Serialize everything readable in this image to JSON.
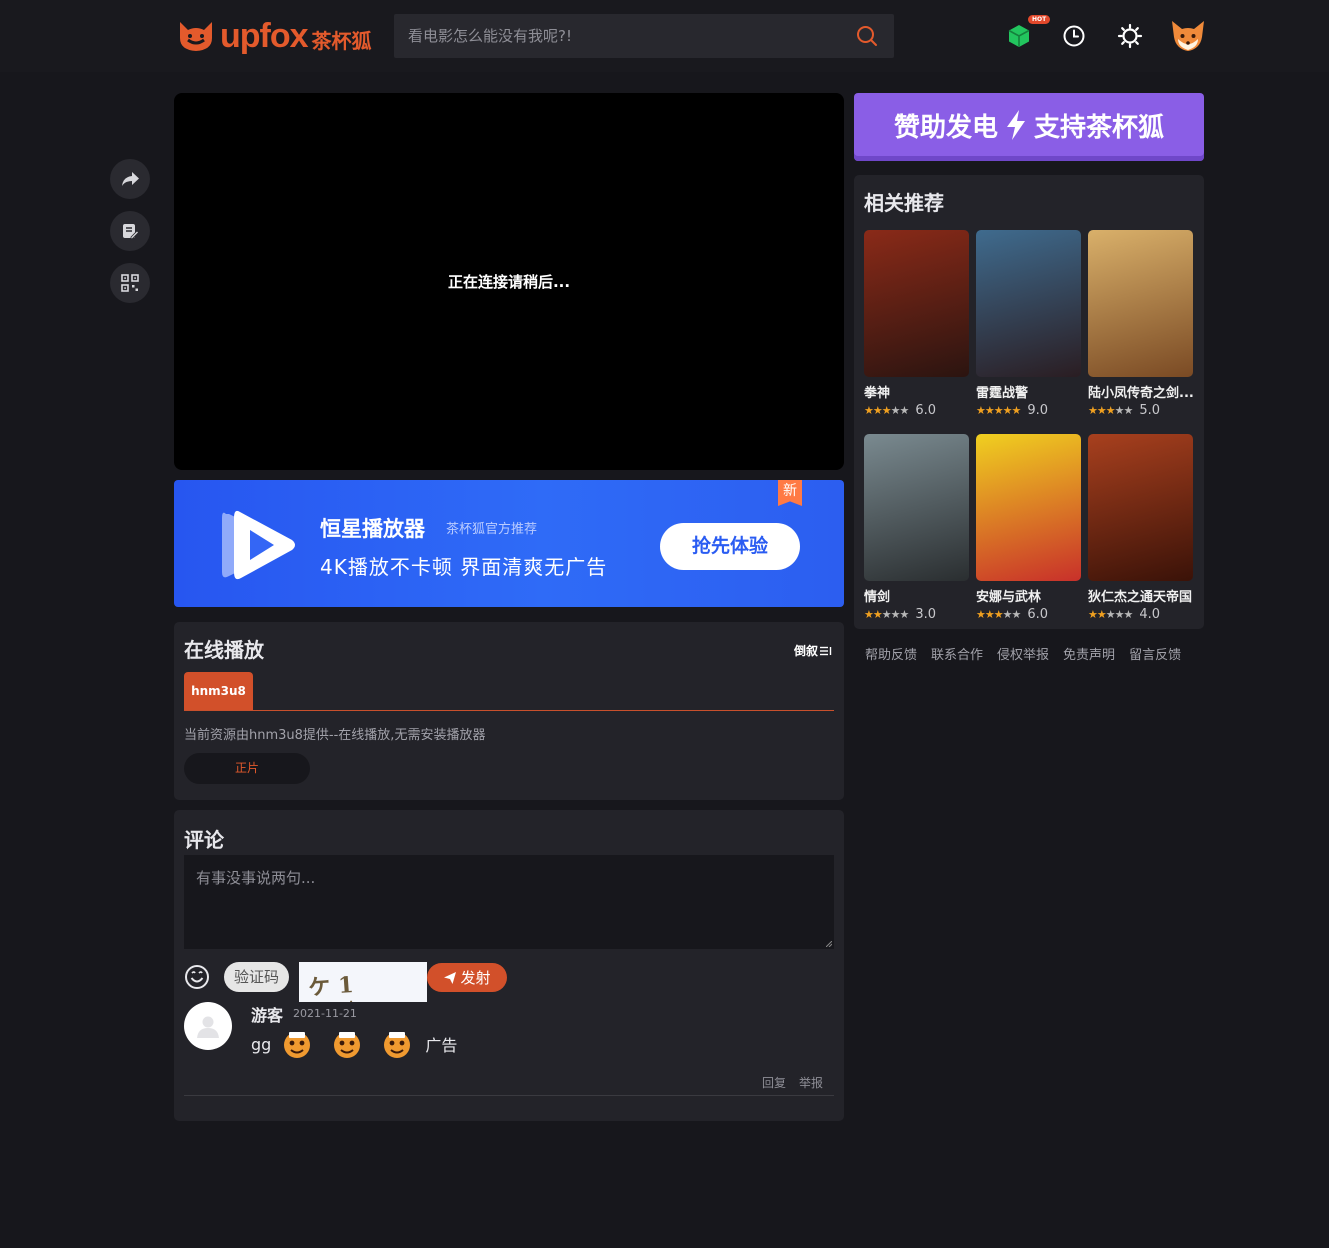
{
  "header": {
    "logo_text": "upfox",
    "logo_cn": "茶杯狐",
    "search_placeholder": "看电影怎么能没有我呢?!",
    "hot_badge": "HOT"
  },
  "player": {
    "status": "正在连接请稍后..."
  },
  "banner": {
    "badge": "新",
    "app_name": "恒星播放器",
    "tagline": "茶杯狐官方推荐",
    "slogan": "4K播放不卡顿 界面清爽无广告",
    "button": "抢先体验"
  },
  "online": {
    "title": "在线播放",
    "sort_label": "倒叙",
    "source_tab": "hnm3u8",
    "source_note": "当前资源由hnm3u8提供--在线播放,无需安装播放器",
    "episode": "正片"
  },
  "comments": {
    "title": "评论",
    "placeholder": "有事没事说两句...",
    "captcha_label": "验证码",
    "captcha_text": "ケ1 ⁂⁂",
    "submit_label": "发射",
    "items": [
      {
        "user": "游客",
        "date": "2021-11-21",
        "text": "gg",
        "trailing_text": "广告",
        "reply": "回复",
        "report": "举报"
      }
    ]
  },
  "sponsor": {
    "text_left": "赞助发电",
    "text_right": "支持茶杯狐"
  },
  "related": {
    "title": "相关推荐",
    "items": [
      {
        "title": "拳神",
        "stars": 3,
        "score": "6.0",
        "colors": [
          "#8a2a18",
          "#2b1410"
        ]
      },
      {
        "title": "雷霆战警",
        "stars": 5,
        "score": "9.0",
        "colors": [
          "#3f6b8e",
          "#2a1d22"
        ]
      },
      {
        "title": "陆小凤传奇之剑...",
        "stars": 2.5,
        "score": "5.0",
        "colors": [
          "#d9b06a",
          "#7a4a24"
        ]
      },
      {
        "title": "情剑",
        "stars": 1.5,
        "score": "3.0",
        "colors": [
          "#7a8a90",
          "#2a2e30"
        ]
      },
      {
        "title": "安娜与武林",
        "stars": 3,
        "score": "6.0",
        "colors": [
          "#f0d020",
          "#c8302a"
        ]
      },
      {
        "title": "狄仁杰之通天帝国",
        "stars": 2,
        "score": "4.0",
        "colors": [
          "#a8401e",
          "#3a1208"
        ]
      }
    ]
  },
  "footer": {
    "links": [
      "帮助反馈",
      "联系合作",
      "侵权举报",
      "免责声明",
      "留言反馈"
    ]
  }
}
